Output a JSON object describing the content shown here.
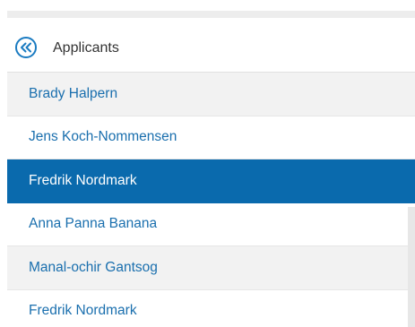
{
  "header": {
    "title": "Applicants",
    "collapse_icon": "double-chevron-left-icon"
  },
  "colors": {
    "accent": "#1a7bc1",
    "selected_row": "#0a6aad",
    "link_text": "#1a6fae",
    "alt_row": "#f2f2f2"
  },
  "applicants": [
    {
      "name": "Brady Halpern",
      "selected": false
    },
    {
      "name": "Jens Koch-Nommensen",
      "selected": false
    },
    {
      "name": "Fredrik Nordmark",
      "selected": true
    },
    {
      "name": "Anna Panna Banana",
      "selected": false
    },
    {
      "name": "Manal-ochir Gantsog",
      "selected": false
    },
    {
      "name": "Fredrik Nordmark",
      "selected": false
    }
  ]
}
